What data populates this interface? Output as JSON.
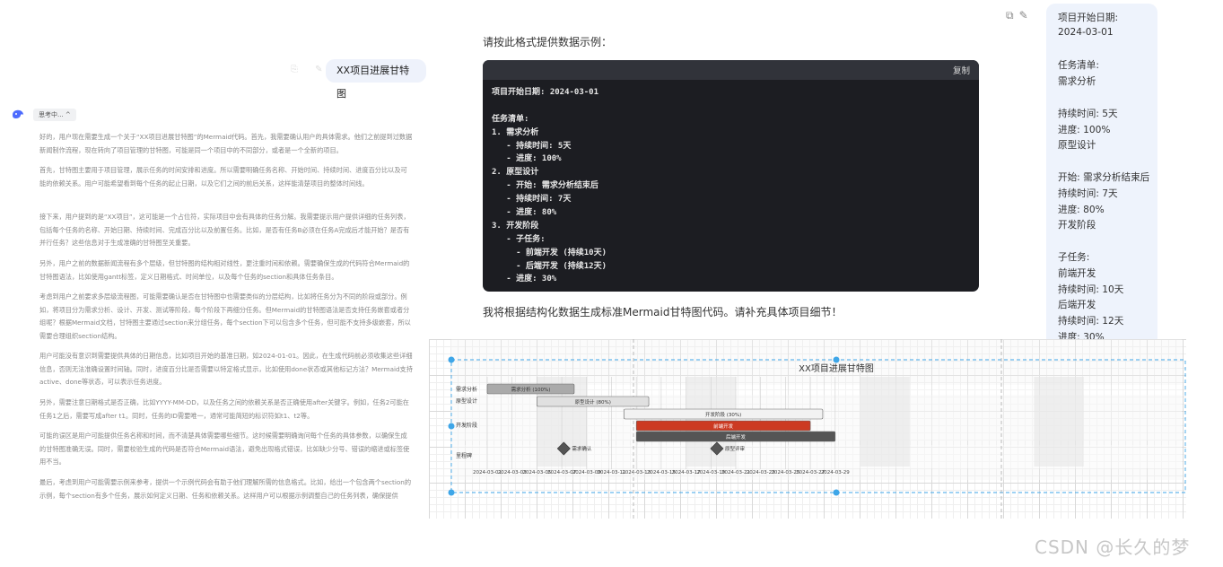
{
  "left": {
    "user_message": "XX项目进展甘特图",
    "thinking_label": "思考中... ^",
    "paragraphs": [
      "好的，用户现在需要生成一个关于“XX项目进展甘特图”的Mermaid代码。首先，我需要确认用户的具体需求。他们之前提到过数据新闻制作流程，现在转向了项目管理的甘特图，可能是同一个项目中的不同部分，或者是一个全新的项目。",
      "首先，甘特图主要用于项目管理，展示任务的时间安排和进度。所以需要明确任务名称、开始时间、持续时间、进度百分比以及可能的依赖关系。用户可能希望看到每个任务的起止日期，以及它们之间的前后关系，这样能清楚项目的整体时间线。",
      "接下来，用户提到的是“XX项目”，这可能是一个占位符，实际项目中会有具体的任务分解。我需要提示用户提供详细的任务列表，包括每个任务的名称、开始日期、持续时间、完成百分比以及前置任务。比如，是否有任务B必须在任务A完成后才能开始？是否有并行任务？这些信息对于生成准确的甘特图至关重要。",
      "另外，用户之前的数据新闻流程有多个层级，但甘特图的结构相对线性，更注重时间和依赖。需要确保生成的代码符合Mermaid的甘特图语法，比如使用gantt标签，定义日期格式、时间单位，以及每个任务的section和具体任务条目。",
      "考虑到用户之前要求多层级流程图，可能需要确认是否在甘特图中也需要类似的分层结构，比如将任务分为不同的阶段或部分。例如，将项目分为需求分析、设计、开发、测试等阶段，每个阶段下再细分任务。但Mermaid的甘特图语法是否支持任务嵌套或者分组呢？根据Mermaid文档，甘特图主要通过section来分组任务，每个section下可以包含多个任务，但可能不支持多级嵌套，所以需要合理组织section结构。",
      "用户可能没有意识到需要提供具体的日期信息，比如项目开始的基准日期，如2024-01-01。因此，在生成代码前必须收集这些详细信息，否则无法准确设置时间轴。同时，进度百分比是否需要以特定格式显示，比如使用done状态或其他标记方法？Mermaid支持active、done等状态，可以表示任务进度。",
      "另外，需要注意日期格式是否正确，比如YYYY-MM-DD，以及任务之间的依赖关系是否正确使用after关键字。例如，任务2可能在任务1之后，需要写成after t1。同时，任务的ID需要唯一，通常可能简短的标识符如t1、t2等。",
      "可能的误区是用户可能提供任务名称和时间，而不清楚具体需要哪些细节。这时候需要明确询问每个任务的具体参数，以确保生成的甘特图准确无误。同时，需要校验生成的代码是否符合Mermaid语法，避免出现格式错误，比如缺少分号、错误的缩进或标签使用不当。",
      "最后，考虑到用户可能需要示例来参考，提供一个示例代码会有助于他们理解所需的信息格式。比如，给出一个包含两个section的示例，每个section有多个任务，展示如何定义日期、任务和依赖关系。这样用户可以根据示例调整自己的任务列表，确保提供"
    ]
  },
  "chat": {
    "prompt_line": "请按此格式提供数据示例：",
    "copy_label": "复制",
    "code_lines": [
      "项目开始日期: 2024-03-01",
      "",
      "任务清单:",
      "1. 需求分析",
      "   - 持续时间: 5天",
      "   - 进度: 100%",
      "2. 原型设计",
      "   - 开始: 需求分析结束后",
      "   - 持续时间: 7天",
      "   - 进度: 80%",
      "3. 开发阶段",
      "   - 子任务:",
      "     - 前端开发 (持续10天)",
      "     - 后端开发 (持续12天)",
      "   - 进度: 30%"
    ],
    "after_line": "我将根据结构化数据生成标准Mermaid甘特图代码。请补充具体项目细节！",
    "user_panel_lines": [
      "项目开始日期:",
      "2024-03-01",
      "",
      "任务清单:",
      "需求分析",
      "",
      "持续时间: 5天",
      "进度: 100%",
      "原型设计",
      "",
      "开始: 需求分析结束后",
      "持续时间: 7天",
      "进度: 80%",
      "开发阶段",
      "",
      "子任务:",
      "前端开发",
      "持续时间: 10天",
      "后端开发",
      "持续时间: 12天",
      "进度: 30%"
    ]
  },
  "gantt": {
    "title": "XX项目进展甘特图",
    "sections": [
      "需求分析",
      "原型设计",
      "开发阶段",
      "里程碑"
    ],
    "start_date": "2024-03-01",
    "tasks": [
      {
        "label": "需求分析 (100%)",
        "start": 0,
        "days": 7,
        "lane": 0,
        "color": "#aaaaaa"
      },
      {
        "label": "原型设计 (80%)",
        "start": 4,
        "days": 9,
        "lane": 1,
        "color": "#e0e0e0"
      },
      {
        "label": "开发阶段 (30%)",
        "start": 11,
        "days": 16,
        "lane": 2,
        "color": "#f2f2f2"
      },
      {
        "label": "前端开发",
        "start": 12,
        "days": 14,
        "lane": 3,
        "color": "#cc3a22"
      },
      {
        "label": "后端开发",
        "start": 12,
        "days": 16,
        "lane": 4,
        "color": "#555555"
      }
    ],
    "milestones": [
      {
        "label": "需求确认",
        "day": 3.5
      },
      {
        "label": "原型评审",
        "day": 10.5
      }
    ],
    "ticks": [
      "2024-03-01",
      "2024-03-03",
      "2024-03-05",
      "2024-03-07",
      "2024-03-09",
      "2024-03-11",
      "2024-03-13",
      "2024-03-15",
      "2024-03-17",
      "2024-03-19",
      "2024-03-21",
      "2024-03-23",
      "2024-03-25",
      "2024-03-27",
      "2024-03-29"
    ]
  },
  "watermark": "CSDN @长久的梦"
}
